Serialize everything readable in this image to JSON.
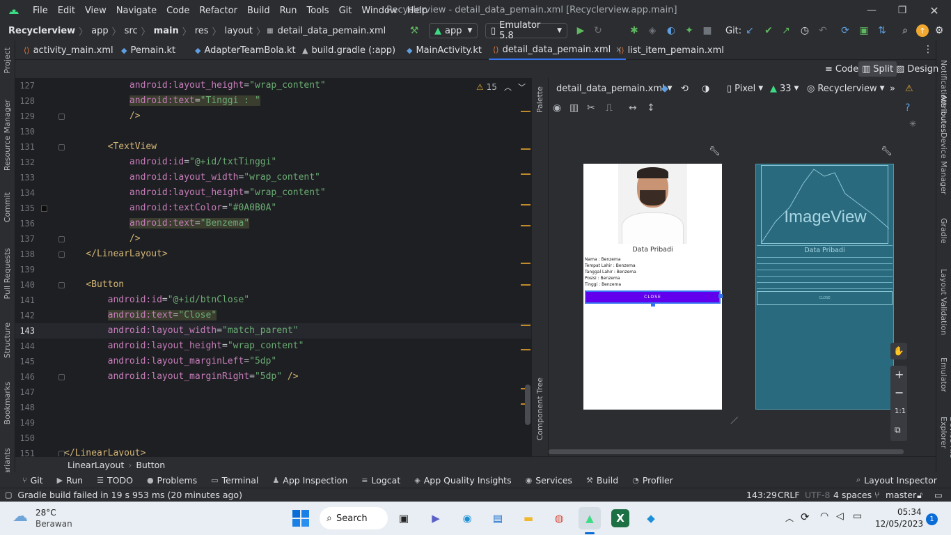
{
  "menu": [
    "File",
    "Edit",
    "View",
    "Navigate",
    "Code",
    "Refactor",
    "Build",
    "Run",
    "Tools",
    "Git",
    "Window",
    "Help"
  ],
  "window_title": "Recyclerview - detail_data_pemain.xml [Recyclerview.app.main]",
  "breadcrumb": [
    "Recyclerview",
    "app",
    "src",
    "main",
    "res",
    "layout",
    "detail_data_pemain.xml"
  ],
  "toolbar": {
    "run_config": "app",
    "device": "Emulator 5.8",
    "git_label": "Git:"
  },
  "tabs": [
    {
      "label": "activity_main.xml",
      "icon": "xml-icon"
    },
    {
      "label": "Pemain.kt",
      "icon": "kotlin-icon"
    },
    {
      "label": "AdapterTeamBola.kt",
      "icon": "kotlin-icon"
    },
    {
      "label": "build.gradle (:app)",
      "icon": "gradle-icon"
    },
    {
      "label": "MainActivity.kt",
      "icon": "kotlin-icon"
    },
    {
      "label": "detail_data_pemain.xml",
      "icon": "xml-icon",
      "active": true
    },
    {
      "label": "list_item_pemain.xml",
      "icon": "xml-icon"
    }
  ],
  "view_modes": [
    "Code",
    "Split",
    "Design"
  ],
  "left_tools": [
    "Project",
    "Resource Manager",
    "Commit",
    "Pull Requests",
    "Structure",
    "Bookmarks",
    "Variants"
  ],
  "right_tools": [
    "Notifications",
    "Attributes",
    "Device Manager",
    "Gradle",
    "Layout Validation",
    "Emulator",
    "Device File Explorer"
  ],
  "editor": {
    "warning_count": "15",
    "lines": [
      {
        "n": "127",
        "indent": "            ",
        "attr": "android:layout_height",
        "val": "\"wrap_content\""
      },
      {
        "n": "128",
        "indent": "            ",
        "attr": "android:text",
        "val": "\"Tinggi : \"",
        "hl": true
      },
      {
        "n": "129",
        "indent": "            ",
        "plain": "/>"
      },
      {
        "n": "130",
        "indent": "",
        "plain": ""
      },
      {
        "n": "131",
        "indent": "        ",
        "tag": "<TextView"
      },
      {
        "n": "132",
        "indent": "            ",
        "attr": "android:id",
        "val": "\"@+id/txtTinggi\""
      },
      {
        "n": "133",
        "indent": "            ",
        "attr": "android:layout_width",
        "val": "\"wrap_content\""
      },
      {
        "n": "134",
        "indent": "            ",
        "attr": "android:layout_height",
        "val": "\"wrap_content\""
      },
      {
        "n": "135",
        "indent": "            ",
        "attr": "android:textColor",
        "val": "\"#0A0B0A\""
      },
      {
        "n": "136",
        "indent": "            ",
        "attr": "android:text",
        "val": "\"Benzema\"",
        "hl": true
      },
      {
        "n": "137",
        "indent": "            ",
        "plain": "/>"
      },
      {
        "n": "138",
        "indent": "    ",
        "tag": "</LinearLayout>"
      },
      {
        "n": "139",
        "indent": "",
        "plain": ""
      },
      {
        "n": "140",
        "indent": "    ",
        "tag": "<Button"
      },
      {
        "n": "141",
        "indent": "        ",
        "attr": "android:id",
        "val": "\"@+id/btnClose\""
      },
      {
        "n": "142",
        "indent": "        ",
        "attr": "android:text",
        "val": "\"Close\"",
        "hl": true
      },
      {
        "n": "143",
        "indent": "        ",
        "attr": "android:layout_width",
        "val": "\"match_parent\"",
        "cur": true
      },
      {
        "n": "144",
        "indent": "        ",
        "attr": "android:layout_height",
        "val": "\"wrap_content\""
      },
      {
        "n": "145",
        "indent": "        ",
        "attr": "android:layout_marginLeft",
        "val": "\"5dp\""
      },
      {
        "n": "146",
        "indent": "        ",
        "attr": "android:layout_marginRight",
        "val": "\"5dp\"",
        "tail": " />"
      },
      {
        "n": "147",
        "indent": "",
        "plain": ""
      },
      {
        "n": "148",
        "indent": "",
        "plain": ""
      },
      {
        "n": "149",
        "indent": "",
        "plain": ""
      },
      {
        "n": "150",
        "indent": "",
        "plain": ""
      },
      {
        "n": "151",
        "indent": "",
        "tag": "</LinearLayout>"
      }
    ]
  },
  "split_labels": {
    "palette": "Palette",
    "component_tree": "Component Tree"
  },
  "design": {
    "file": "detail_data_pemain.xml",
    "device": "Pixel",
    "api": "33",
    "theme": "Recyclerview",
    "preview": {
      "section_title": "Data Pribadi",
      "rows": [
        "Nama : Benzema",
        "Tempat Lahir : Benzema",
        "Tanggal Lahir : Benzema",
        "Posisi : Benzema",
        "Tinggi : Benzema"
      ],
      "button": "CLOSE"
    },
    "blueprint": {
      "image_label": "ImageView",
      "section_title": "Data Pribadi",
      "button": "CLOSE"
    },
    "zoom_label": "1:1"
  },
  "bottom_path": [
    "LinearLayout",
    "Button"
  ],
  "tool_windows": [
    "Git",
    "Run",
    "TODO",
    "Problems",
    "Terminal",
    "App Inspection",
    "Logcat",
    "App Quality Insights",
    "Services",
    "Build",
    "Profiler"
  ],
  "layout_inspector": "Layout Inspector",
  "status": {
    "message": "Gradle build failed in 19 s 953 ms (20 minutes ago)",
    "position": "143:29",
    "line_sep": "CRLF",
    "encoding": "UTF-8",
    "indent": "4 spaces",
    "branch": "master"
  },
  "taskbar": {
    "weather_temp": "28°C",
    "weather_desc": "Berawan",
    "search": "Search",
    "time": "05:34",
    "date": "12/05/2023",
    "notif": "1"
  },
  "colors": {
    "accent": "#3574f0",
    "button_purple": "#6200ee",
    "blueprint": "#2a6a7e"
  }
}
